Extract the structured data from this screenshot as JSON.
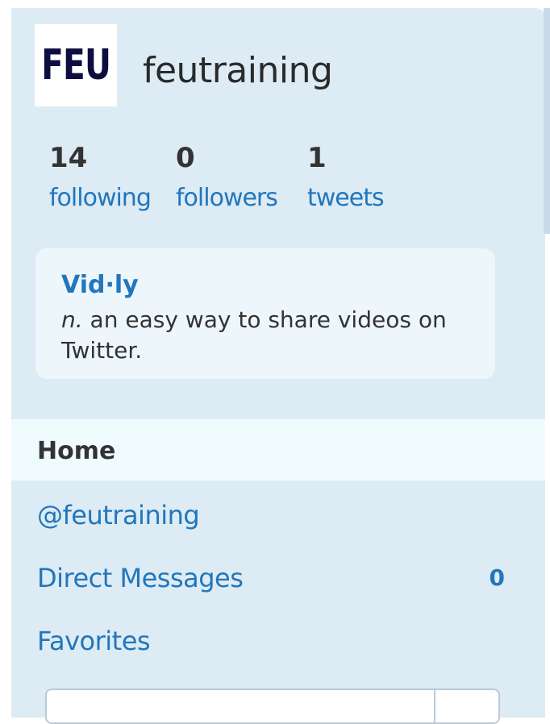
{
  "profile": {
    "logo_text": "FEU",
    "username": "feutraining"
  },
  "stats": [
    {
      "count": "14",
      "label": "following"
    },
    {
      "count": "0",
      "label": "followers"
    },
    {
      "count": "1",
      "label": "tweets"
    }
  ],
  "promo": {
    "title": "Vid·ly",
    "pos": "n.",
    "definition": " an easy way to share videos on Twitter."
  },
  "nav": {
    "home": "Home",
    "mentions": "@feutraining",
    "direct_messages": "Direct Messages",
    "direct_messages_count": "0",
    "favorites": "Favorites"
  },
  "colors": {
    "panel_bg": "#dcebf4",
    "link": "#2276bb",
    "active_row_bg": "#f0fbfd"
  }
}
